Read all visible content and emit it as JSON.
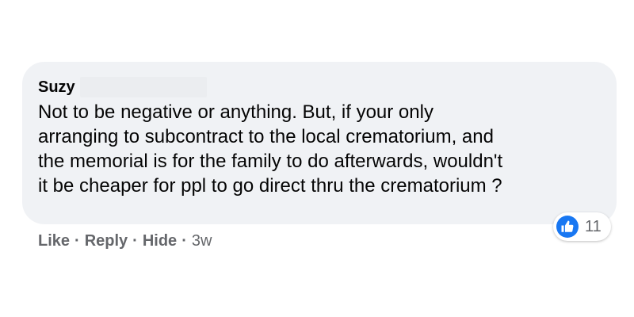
{
  "comment": {
    "author": "Suzy",
    "lines": [
      "Not to be negative or anything. But, if your only",
      "arranging to subcontract to the local crematorium, and",
      "the memorial is for the family to do afterwards, wouldn't",
      "it be cheaper for ppl to go direct thru the crematorium ?"
    ]
  },
  "reactions": {
    "icon": "thumbs-up-icon",
    "count": "11",
    "color": "#1877f2"
  },
  "actions": {
    "like": "Like",
    "reply": "Reply",
    "hide": "Hide",
    "separator": "·",
    "timestamp": "3w"
  },
  "colors": {
    "bubble": "#f0f2f5",
    "text": "#050505",
    "secondary": "#65676b"
  }
}
